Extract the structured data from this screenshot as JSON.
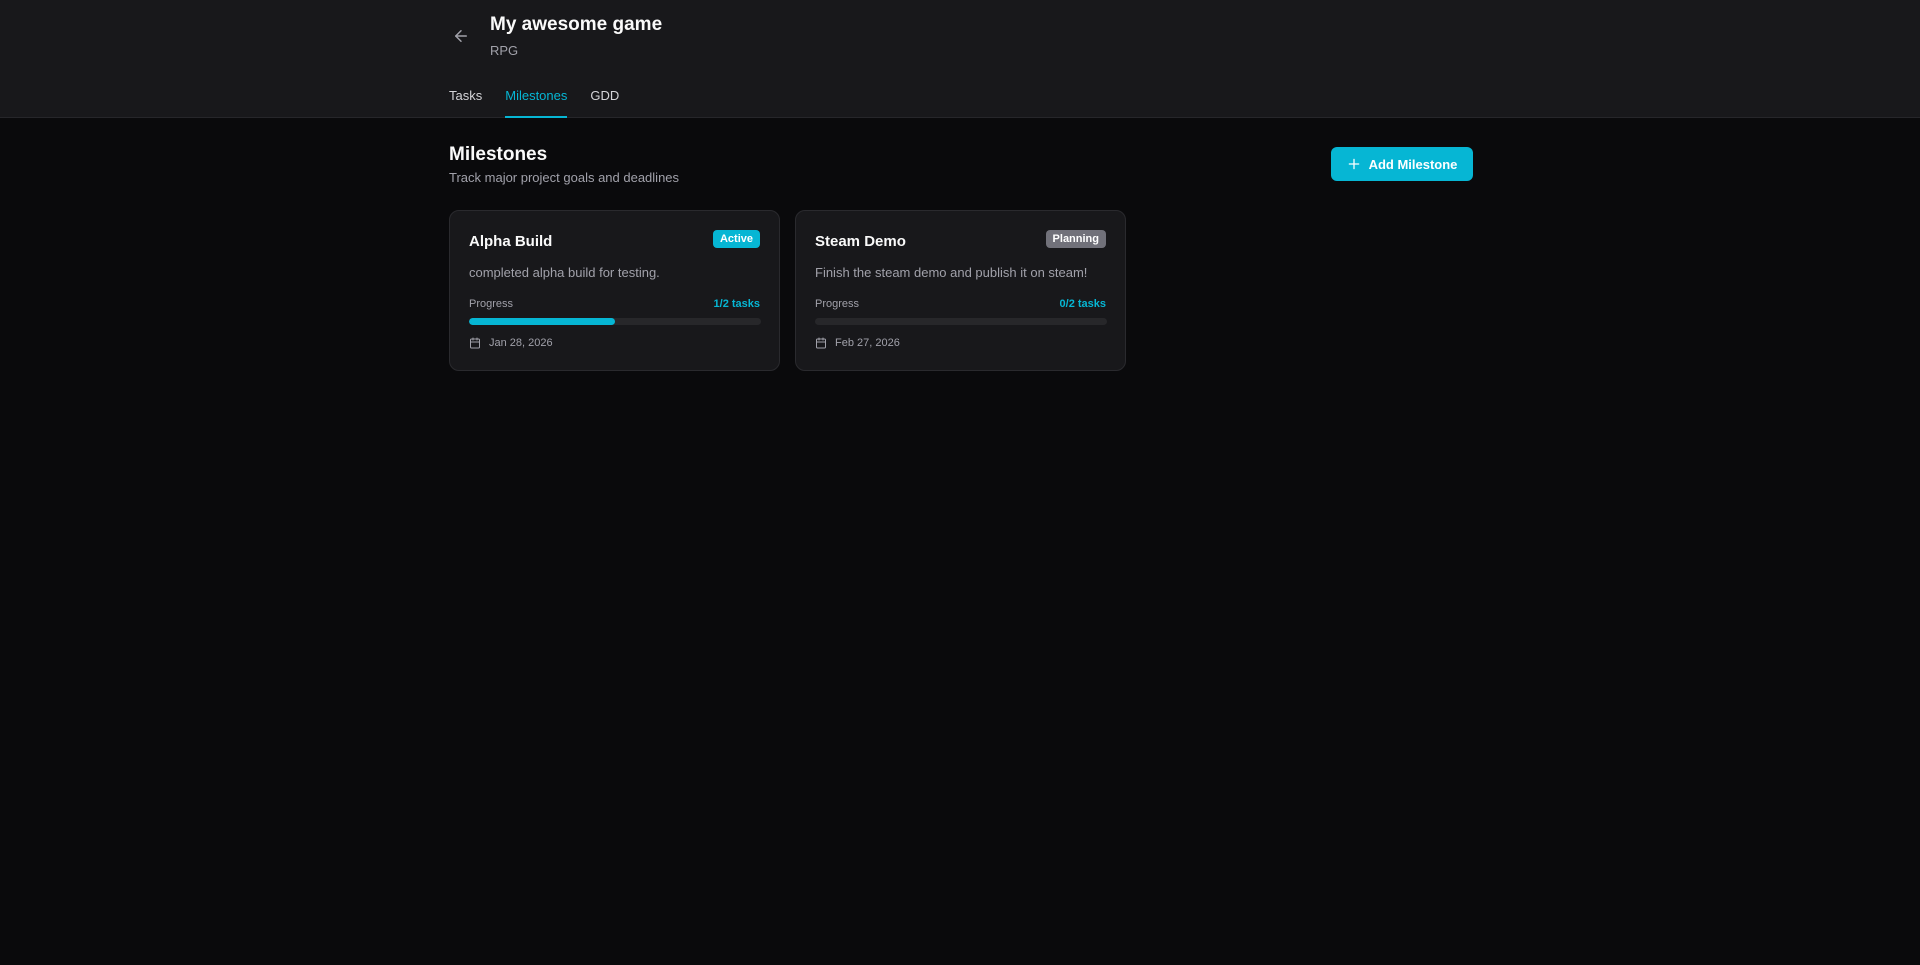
{
  "header": {
    "back_icon": "arrow-left-icon",
    "title": "My awesome game",
    "genre": "RPG",
    "tabs": [
      {
        "label": "Tasks",
        "active": false
      },
      {
        "label": "Milestones",
        "active": true
      },
      {
        "label": "GDD",
        "active": false
      }
    ]
  },
  "section": {
    "title": "Milestones",
    "subtitle": "Track major project goals and deadlines",
    "add_button_label": "Add Milestone",
    "add_button_icon": "plus-icon"
  },
  "milestones": [
    {
      "title": "Alpha Build",
      "status": "Active",
      "description": "completed alpha build for testing.",
      "progress_label": "Progress",
      "progress_text": "1/2 tasks",
      "progress_fraction": 0.5,
      "date": "Jan 28, 2026",
      "date_icon": "calendar-icon"
    },
    {
      "title": "Steam Demo",
      "status": "Planning",
      "description": "Finish the steam demo and publish it on steam!",
      "progress_label": "Progress",
      "progress_text": "0/2 tasks",
      "progress_fraction": 0,
      "date": "Feb 27, 2026",
      "date_icon": "calendar-icon"
    }
  ],
  "colors": {
    "accent": "#06b6d4",
    "background": "#0a0a0c",
    "header_background": "#18181b",
    "card_background": "#18181b",
    "planning_badge": "#71717a"
  }
}
